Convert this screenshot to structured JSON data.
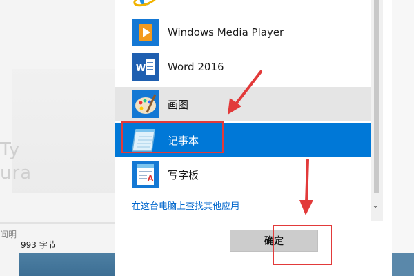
{
  "background": {
    "status_text": "993 字节",
    "partial_label": "闻明",
    "ghost_text": "Ty\nura"
  },
  "dialog": {
    "apps": [
      {
        "label": "Windows Media Player",
        "icon": "media-player-icon"
      },
      {
        "label": "Word 2016",
        "icon": "word-icon"
      },
      {
        "label": "画图",
        "icon": "paint-icon"
      },
      {
        "label": "记事本",
        "icon": "notepad-icon"
      },
      {
        "label": "写字板",
        "icon": "wordpad-icon"
      }
    ],
    "top_partial_icon": "internet-explorer-icon",
    "selected_index": 3,
    "hover_index": 2,
    "more_apps_link": "在这台电脑上查找其他应用",
    "ok_button": "确定"
  },
  "colors": {
    "selected": "#0078d7",
    "hover": "#e5e5e5",
    "link": "#0066cc",
    "annotation": "#e23a3a"
  }
}
